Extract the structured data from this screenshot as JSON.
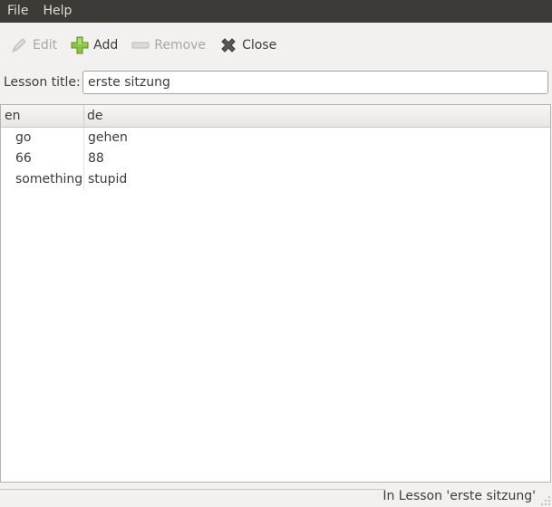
{
  "menubar": {
    "items": [
      {
        "label": "File"
      },
      {
        "label": "Help"
      }
    ]
  },
  "toolbar": {
    "edit": {
      "label": "Edit",
      "icon": "pencil-icon",
      "enabled": false
    },
    "add": {
      "label": "Add",
      "icon": "plus-icon",
      "enabled": true
    },
    "remove": {
      "label": "Remove",
      "icon": "minus-icon",
      "enabled": false
    },
    "close": {
      "label": "Close",
      "icon": "close-x-icon",
      "enabled": true
    }
  },
  "lesson": {
    "title_label": "Lesson title:",
    "title_value": "erste sitzung"
  },
  "table": {
    "columns": [
      {
        "label": "en"
      },
      {
        "label": "de"
      }
    ],
    "rows": [
      {
        "en": "go",
        "de": "gehen"
      },
      {
        "en": "66",
        "de": "88"
      },
      {
        "en": "something",
        "de": "stupid"
      }
    ]
  },
  "status": {
    "text": "In Lesson 'erste sitzung'"
  },
  "colors": {
    "menubar_bg": "#3c3b37",
    "window_bg": "#f2f1f0",
    "add_icon_green": "#8cc63f",
    "disabled_text": "#a9a7a4"
  }
}
